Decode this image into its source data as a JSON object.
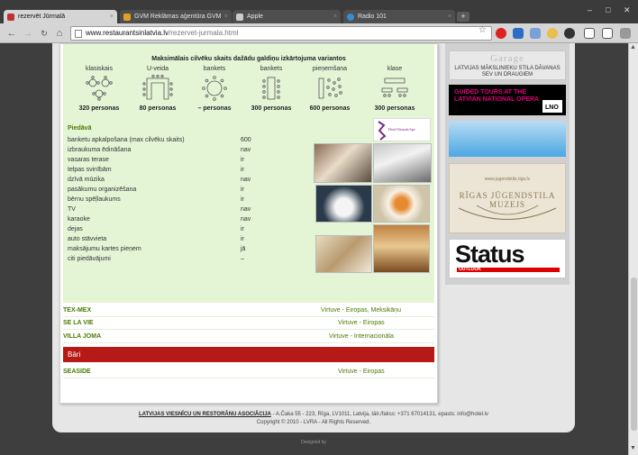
{
  "browser": {
    "tabs": [
      {
        "title": "rezervēt Jūrmalā",
        "favicon_color": "#c03030",
        "active": true
      },
      {
        "title": "GVM Reklāmas aģentūra GVM",
        "favicon_color": "#e0a020",
        "active": false
      },
      {
        "title": "Apple",
        "favicon_color": "#cccccc",
        "active": false
      },
      {
        "title": "Radio 101",
        "favicon_color": "#3a8ad0",
        "active": false
      }
    ],
    "new_tab": "+",
    "window_controls": [
      "–",
      "□",
      "✕"
    ],
    "url_host": "www.restaurantsinlatvia.lv",
    "url_path": "/rezervet-jurmala.html",
    "nav": {
      "back": "←",
      "forward": "→",
      "home": "⌂",
      "star": "☆",
      "close": "×"
    }
  },
  "seating": {
    "title": "Maksimālais cilvēku skaits dažādu galdiņu izkārtojuma variantos",
    "layouts": [
      {
        "label": "klasiskais",
        "count": "320 personas",
        "icon": "round-tables-icon"
      },
      {
        "label": "U-veida",
        "count": "80 personas",
        "icon": "u-table-icon"
      },
      {
        "label": "bankets",
        "count": "– personas",
        "icon": "round-banquet-icon"
      },
      {
        "label": "bankets",
        "count": "300 personas",
        "icon": "long-banquet-icon"
      },
      {
        "label": "pieņemšana",
        "count": "600 personas",
        "icon": "reception-icon"
      },
      {
        "label": "klase",
        "count": "300 personas",
        "icon": "classroom-icon"
      }
    ]
  },
  "offers": {
    "title": "Piedāvā",
    "items": [
      {
        "label": "banketu apkalpošana (max cilvēku skaits)",
        "value": "600"
      },
      {
        "label": "izbraukuma ēdināšana",
        "value": "nav"
      },
      {
        "label": "vasaras terase",
        "value": "ir"
      },
      {
        "label": "telpas svinībām",
        "value": "ir"
      },
      {
        "label": "dzīvā mūzika",
        "value": "nav"
      },
      {
        "label": "pasākumu organizēšana",
        "value": "ir"
      },
      {
        "label": "bērnu spēļlaukums",
        "value": "ir"
      },
      {
        "label": "TV",
        "value": "nav"
      },
      {
        "label": "karaoke",
        "value": "nav"
      },
      {
        "label": "dejas",
        "value": "ir"
      },
      {
        "label": "auto stāvvieta",
        "value": "ir"
      },
      {
        "label": "maksājumu kartes pieņem",
        "value": "jā"
      },
      {
        "label": "citi piedāvājumi",
        "value": "–"
      }
    ],
    "hotel_logo_text": "Hotel Jūrmala Spa"
  },
  "restaurants": [
    {
      "name": "TEX-MEX",
      "kitchen": "Virtuve - Eiropas, Meksikāņu"
    },
    {
      "name": "SE LA VIE",
      "kitchen": "Virtuve - Eiropas"
    },
    {
      "name": "VILLA JOMA",
      "kitchen": "Virtuve - Internacionāla"
    }
  ],
  "bars": {
    "header": "Bāri",
    "items": [
      {
        "name": "SEASIDE",
        "kitchen": "Virtuve - Eiropas"
      }
    ]
  },
  "footer": {
    "org": "LATVIJAS VIESNĪCU UN RESTORĀNU ASOCIĀCIJA",
    "address": " - A.Čaka 55 - 223, Rīga, LV1011, Latvija, tālr./fakss: +371 67014131, epasts: info@hotel.lv",
    "copyright": "Copyright © 2010 - LVRA - All Rights Reserved.",
    "designed": "Designed by"
  },
  "banners": {
    "garage_title": "Garage",
    "garage_sub1": "LATVIJAS MĀKSLINIEKU STILA DĀVANAS",
    "garage_sub2": "SEV UN DRAUGIEM",
    "opera_text1": "GUIDED TOURS AT THE",
    "opera_text2": "LATVIAN NATIONAL OPERA",
    "jugend_url": "www.jugendstils.riga.lv",
    "jugend_title": "RĪGAS JŪGENDSTILA MUZEJS",
    "status_title": "Status",
    "status_sub": "OUTLOOK"
  },
  "colors": {
    "accent_green": "#4a7a00",
    "bars_red": "#b51a16",
    "panel_green": "#e4f5d6"
  }
}
